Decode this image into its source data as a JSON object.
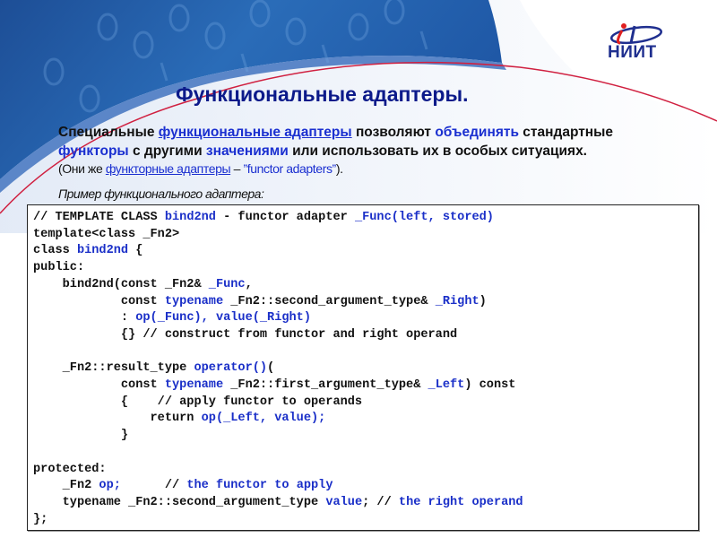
{
  "header": {
    "title": "Функциональные адаптеры.",
    "logo": {
      "mark": "it",
      "text": "НИИТ",
      "icon": "niit-logo-icon"
    },
    "colors": {
      "wave_blue": "#1f5aa8",
      "curve_red": "#d02040",
      "title": "#0c1a8a",
      "accent": "#1a2fd0"
    }
  },
  "intro": {
    "line1_a": "Специальные ",
    "line1_link": "функциональные адаптеры",
    "line1_b": " позволяют ",
    "line1_hl": "объединять",
    "line1_c": " стандартные",
    "line2_hl1": "функторы",
    "line2_a": " с другими ",
    "line2_hl2": "значениями",
    "line2_b": " или использовать  их в особых ситуациях."
  },
  "note": {
    "prefix": "(Они же ",
    "link": "функторные адаптеры",
    "dash": " – ",
    "quote": "”functor adapters”",
    "suffix": ")."
  },
  "example_label": "Пример функционального адаптера:",
  "code": {
    "lines": [
      [
        {
          "t": "// TEMPLATE CLASS "
        },
        {
          "t": "bind2nd",
          "k": 1
        },
        {
          "t": " - functor adapter "
        },
        {
          "t": "_Func(left, stored)",
          "k": 1
        }
      ],
      [
        {
          "t": "template<class _Fn2>"
        }
      ],
      [
        {
          "t": "class "
        },
        {
          "t": "bind2nd",
          "k": 1
        },
        {
          "t": " {"
        }
      ],
      [
        {
          "t": "public:"
        }
      ],
      [
        {
          "t": "    bind2nd(const _Fn2& "
        },
        {
          "t": "_Func",
          "k": 1
        },
        {
          "t": ","
        }
      ],
      [
        {
          "t": "            const "
        },
        {
          "t": "typename",
          "k": 1
        },
        {
          "t": " _Fn2::second_argument_type& "
        },
        {
          "t": "_Right",
          "k": 1
        },
        {
          "t": ")"
        }
      ],
      [
        {
          "t": "            : "
        },
        {
          "t": "op(_Func), value(_Right)",
          "k": 1
        }
      ],
      [
        {
          "t": "            {} // construct from functor and right operand"
        }
      ],
      [
        {
          "t": ""
        }
      ],
      [
        {
          "t": "    _Fn2::result_type "
        },
        {
          "t": "operator()",
          "k": 1
        },
        {
          "t": "("
        }
      ],
      [
        {
          "t": "            const "
        },
        {
          "t": "typename",
          "k": 1
        },
        {
          "t": " _Fn2::first_argument_type& "
        },
        {
          "t": "_Left",
          "k": 1
        },
        {
          "t": ") const"
        }
      ],
      [
        {
          "t": "            {    // apply functor to operands"
        }
      ],
      [
        {
          "t": "                return "
        },
        {
          "t": "op(_Left, value);",
          "k": 1
        }
      ],
      [
        {
          "t": "            }"
        }
      ],
      [
        {
          "t": ""
        }
      ],
      [
        {
          "t": "protected:"
        }
      ],
      [
        {
          "t": "    _Fn2 "
        },
        {
          "t": "op;",
          "k": 1
        },
        {
          "t": "      // "
        },
        {
          "t": "the functor to apply",
          "k": 1
        }
      ],
      [
        {
          "t": "    typename _Fn2::second_argument_type "
        },
        {
          "t": "value",
          "k": 1
        },
        {
          "t": "; // "
        },
        {
          "t": "the right operand",
          "k": 1
        }
      ],
      [
        {
          "t": "};"
        }
      ]
    ]
  }
}
